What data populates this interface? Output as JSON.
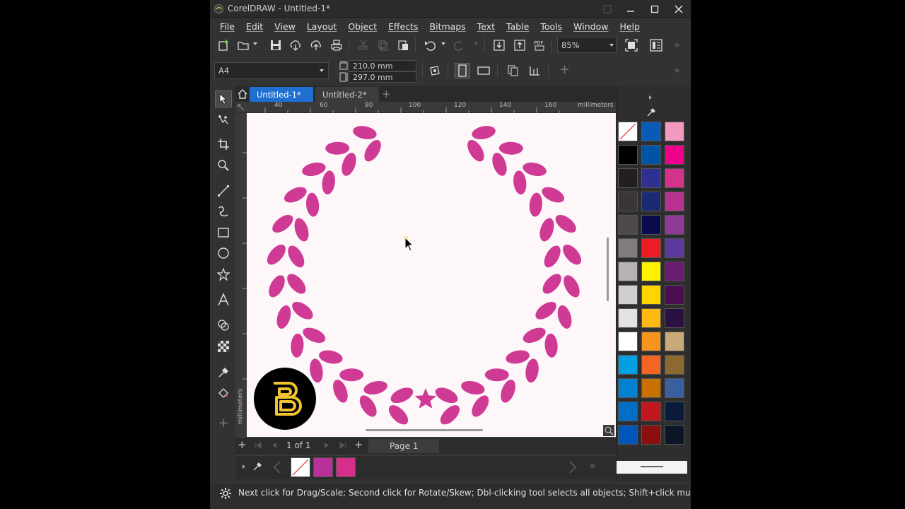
{
  "window": {
    "title": "CorelDRAW - Untitled-1*"
  },
  "menu": [
    "File",
    "Edit",
    "View",
    "Layout",
    "Object",
    "Effects",
    "Bitmaps",
    "Text",
    "Table",
    "Tools",
    "Window",
    "Help"
  ],
  "toolbar": {
    "zoom": "85%"
  },
  "property_bar": {
    "page_size": "A4",
    "width": "210.0 mm",
    "height": "297.0 mm"
  },
  "tabs": [
    {
      "label": "Untitled-1*",
      "active": true
    },
    {
      "label": "Untitled-2*",
      "active": false
    }
  ],
  "ruler": {
    "h_ticks": [
      "40",
      "60",
      "80",
      "100",
      "120",
      "140",
      "160"
    ],
    "h_unit": "millimeters",
    "v_unit": "millimeters"
  },
  "page_nav": {
    "current": "1",
    "of_label": "of",
    "total": "1",
    "page_tab": "Page 1"
  },
  "palette": {
    "columns": [
      [
        "none",
        "#000000",
        "#231f20",
        "#3a3536",
        "#4e4a4b",
        "#807c7d",
        "#b6b2b3",
        "#d1cecf",
        "#e3e1e1",
        "#ffffff",
        "#00a0e3",
        "#0082d0",
        "#006ec7",
        "#0055b8"
      ],
      [
        "#0a5bb7",
        "#0054a6",
        "#2e3192",
        "#1b2a72",
        "#0b0b4e",
        "#ed1c24",
        "#fff200",
        "#ffd400",
        "#fdb813",
        "#f7941d",
        "#f26522",
        "#c87000",
        "#c0181e",
        "#8b0f0f"
      ],
      [
        "#f49ac1",
        "#ec008c",
        "#d5328b",
        "#b83290",
        "#8e3a96",
        "#5b3a9c",
        "#6a1b6f",
        "#4a0f4f",
        "#2a1142",
        "#c8a977",
        "#8b6a2f",
        "#3a5f9e",
        "#0a1a3a",
        "#0d1627"
      ]
    ]
  },
  "document_palette": [
    "none",
    "#b8319a",
    "#d52f8b"
  ],
  "status": {
    "hint": "Next click for Drag/Scale; Second click for Rotate/Skew; Dbl-clicking tool selects all objects; Shift+click multi-selects; Alt-"
  },
  "colors": {
    "laurel": "#cf3a94",
    "accent_tab": "#1e6fd0",
    "logo_gold": "#f2c230"
  }
}
